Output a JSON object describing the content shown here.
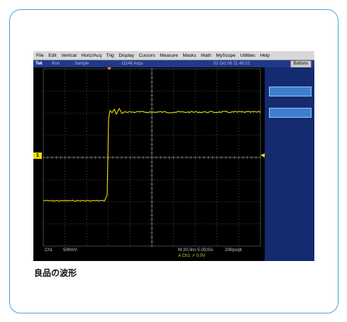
{
  "menu": [
    "File",
    "Edit",
    "Vertical",
    "Horiz/Acq",
    "Trig",
    "Display",
    "Cursors",
    "Measure",
    "Masks",
    "Math",
    "MyScope",
    "Utilities",
    "Help"
  ],
  "status": {
    "brand": "Tek",
    "mode": "Run",
    "acq_mode": "Sample",
    "acq_count": "11146 Acqs",
    "datetime": "02 Oct 06 21:49:22",
    "buttons_label": "Buttons"
  },
  "channel_marker": "1",
  "readouts": {
    "ch1": "Ch1",
    "scale": "500mV",
    "timebase": "M 20.0ns 5.0GS/s",
    "record": "200ps/pt",
    "trigger": "A  Ch1  ↗  0.0V"
  },
  "caption": "良品の波形",
  "colors": {
    "card_border": "#4aa3e0",
    "trace": "#e8e000",
    "grid": "#5a5a5a",
    "status_bg": "#1f3a8a",
    "side_panel": "#152b70"
  }
}
